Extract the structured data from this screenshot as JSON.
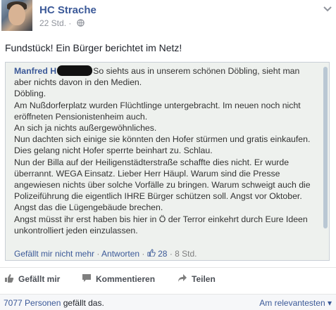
{
  "post": {
    "author": "HC Strache",
    "time": "22 Std.",
    "text": "Fundstück! Ein Bürger berichtet im Netz!"
  },
  "embed": {
    "user": "Manfred H",
    "lines": [
      "So siehts aus in unserem schönen Döbling, sieht man",
      "aber nichts davon in den Medien.",
      "Döbling.",
      "Am Nußdorferplatz wurden Flüchtlinge untergebracht. Im neuen noch nicht",
      "eröffneten Pensionistenheim auch.",
      "An sich ja nichts außergewöhnliches.",
      "Nun dachten sich einige sie könnten den Hofer stürmen und gratis einkaufen.",
      "Dies gelang nicht Hofer sperrte beinhart zu. Schlau.",
      "Nun der Billa auf der Heiligenstädterstraße schaffte dies nicht. Er wurde",
      "überrannt. WEGA Einsatz. Lieber Herr Häupl. Warum sind die Presse",
      "angewiesen nichts über solche Vorfälle zu bringen. Warum schweigt auch die",
      "Polizeiführung die eigentlich IHRE Bürger schützen soll. Angst vor Oktober.",
      "Angst das die Lügengebäude brechen.",
      "Angst müsst ihr erst haben bis hier in Ö der Terror einkehrt durch Eure Ideen",
      "unkontrolliert jeden einzulassen."
    ],
    "like_label": "Gefällt mir nicht mehr",
    "reply_label": "Antworten",
    "like_count": "28",
    "time": "8 Std."
  },
  "actions": {
    "like": "Gefällt mir",
    "comment": "Kommentieren",
    "share": "Teilen"
  },
  "footer": {
    "count": "7077 Personen",
    "suffix": "gefällt das.",
    "sort": "Am relevantesten"
  },
  "colors": {
    "link": "#3b5998",
    "muted": "#90949c"
  }
}
